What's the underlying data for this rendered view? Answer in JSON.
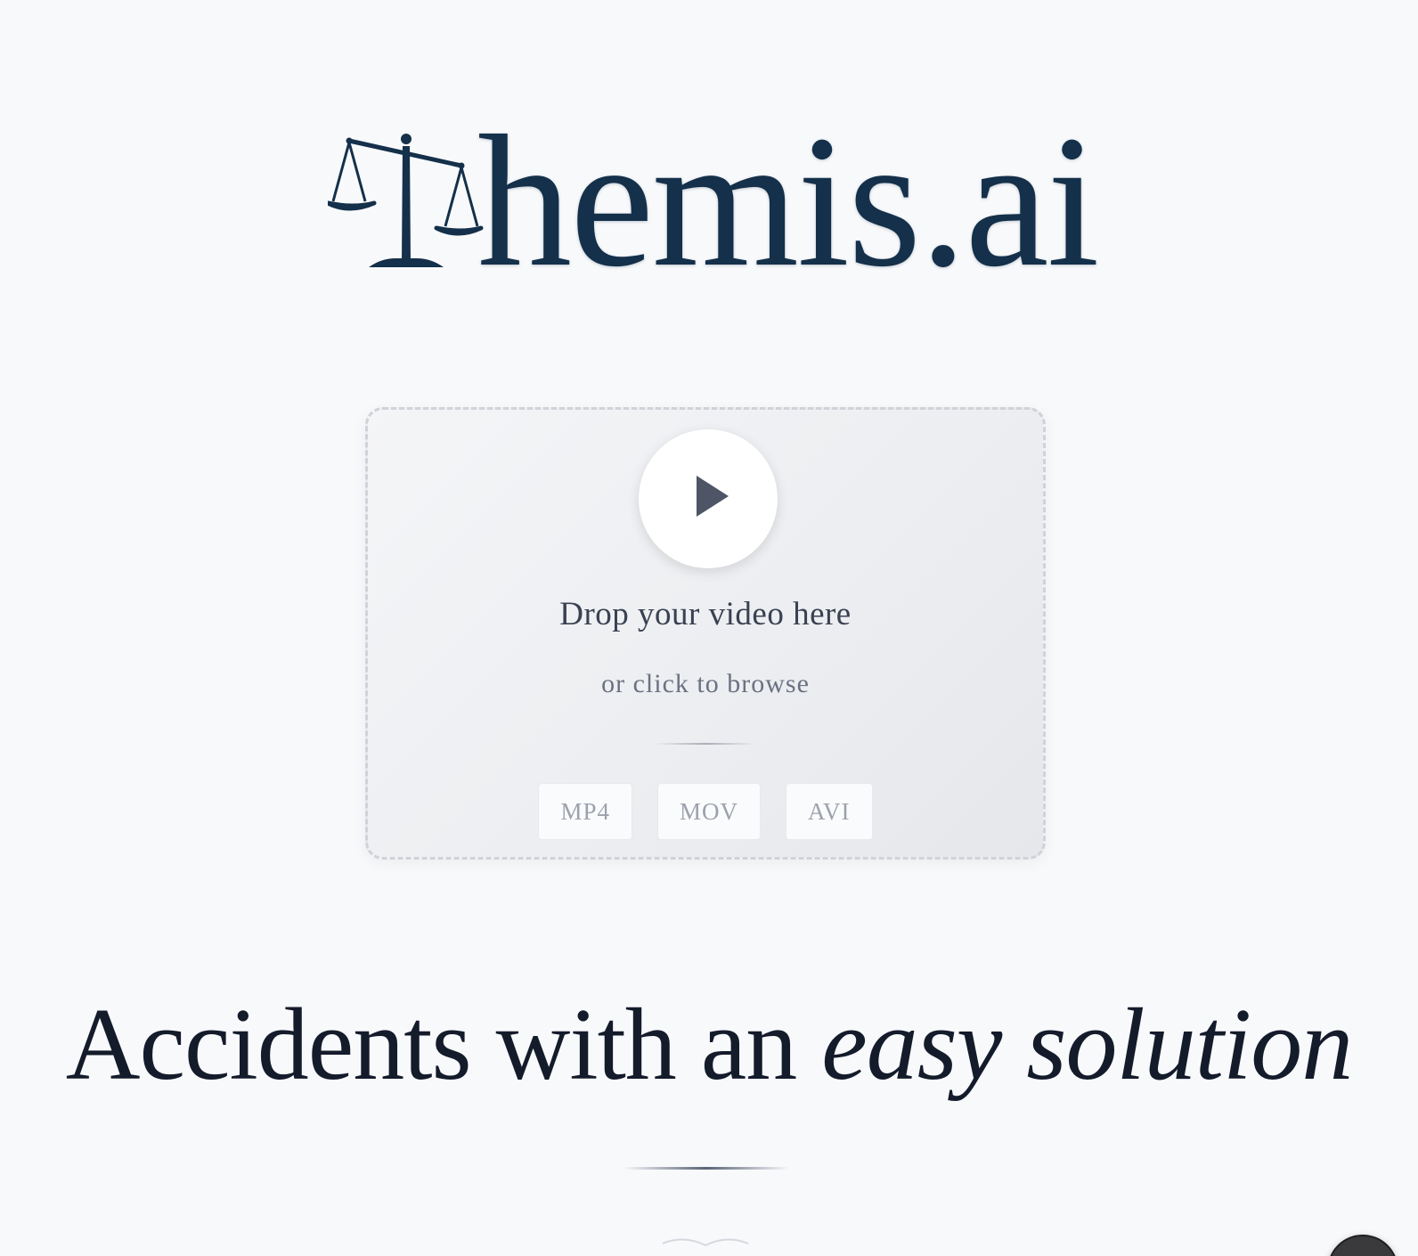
{
  "brand": {
    "name": "hemis.ai",
    "logo_color": "#14304a"
  },
  "upload": {
    "title": "Drop your video here",
    "subtitle": "or click to browse",
    "formats": [
      "MP4",
      "MOV",
      "AVI"
    ],
    "icon": "play-icon"
  },
  "hero": {
    "headline_plain": "Accidents with an ",
    "headline_emphasis": "easy solution"
  },
  "colors": {
    "background": "#f8f9fb",
    "text_dark": "#141b2b",
    "muted": "#6b7181"
  }
}
